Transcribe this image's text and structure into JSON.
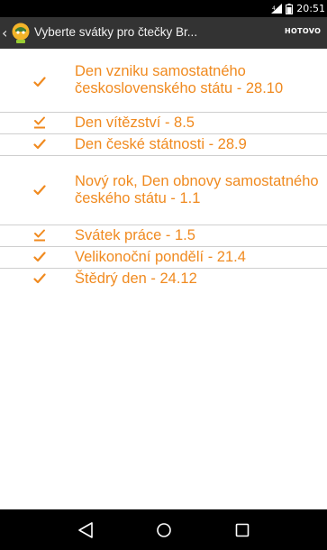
{
  "status_bar": {
    "time": "20:51",
    "icons": [
      "signal-icon",
      "battery-icon"
    ]
  },
  "action_bar": {
    "back_icon": "chevron-left-icon",
    "app_icon": "app-logo-icon",
    "title": "Vyberte svátky pro čtečky Br...",
    "done_label": "HOTOVO"
  },
  "holidays": [
    {
      "label": "Den vzniku samostatného československého státu - 28.10",
      "checked": true,
      "style": "check"
    },
    {
      "label": "Den vítězství - 8.5",
      "checked": true,
      "style": "box"
    },
    {
      "label": "Den české státnosti - 28.9",
      "checked": true,
      "style": "check"
    },
    {
      "label": "Nový rok, Den obnovy samostatného českého státu - 1.1",
      "checked": true,
      "style": "check"
    },
    {
      "label": "Svátek práce - 1.5",
      "checked": true,
      "style": "box"
    },
    {
      "label": "Velikonoční pondělí - 21.4",
      "checked": true,
      "style": "check"
    },
    {
      "label": "Štědrý den - 24.12",
      "checked": true,
      "style": "check"
    }
  ],
  "nav_bar": {
    "icons": [
      "back-triangle-icon",
      "home-circle-icon",
      "recents-square-icon"
    ]
  },
  "colors": {
    "accent": "#f08a1f",
    "action_bar": "#333333",
    "status_bar": "#000000"
  }
}
